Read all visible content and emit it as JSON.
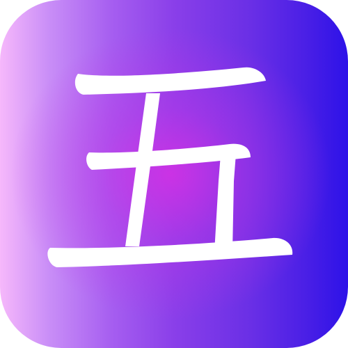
{
  "app_icon": {
    "character": "五",
    "colors": {
      "gradient_start": "#f6b8fb",
      "gradient_mid": "#d230e4",
      "gradient_end": "#2d12e8",
      "glyph": "#ffffff"
    }
  }
}
